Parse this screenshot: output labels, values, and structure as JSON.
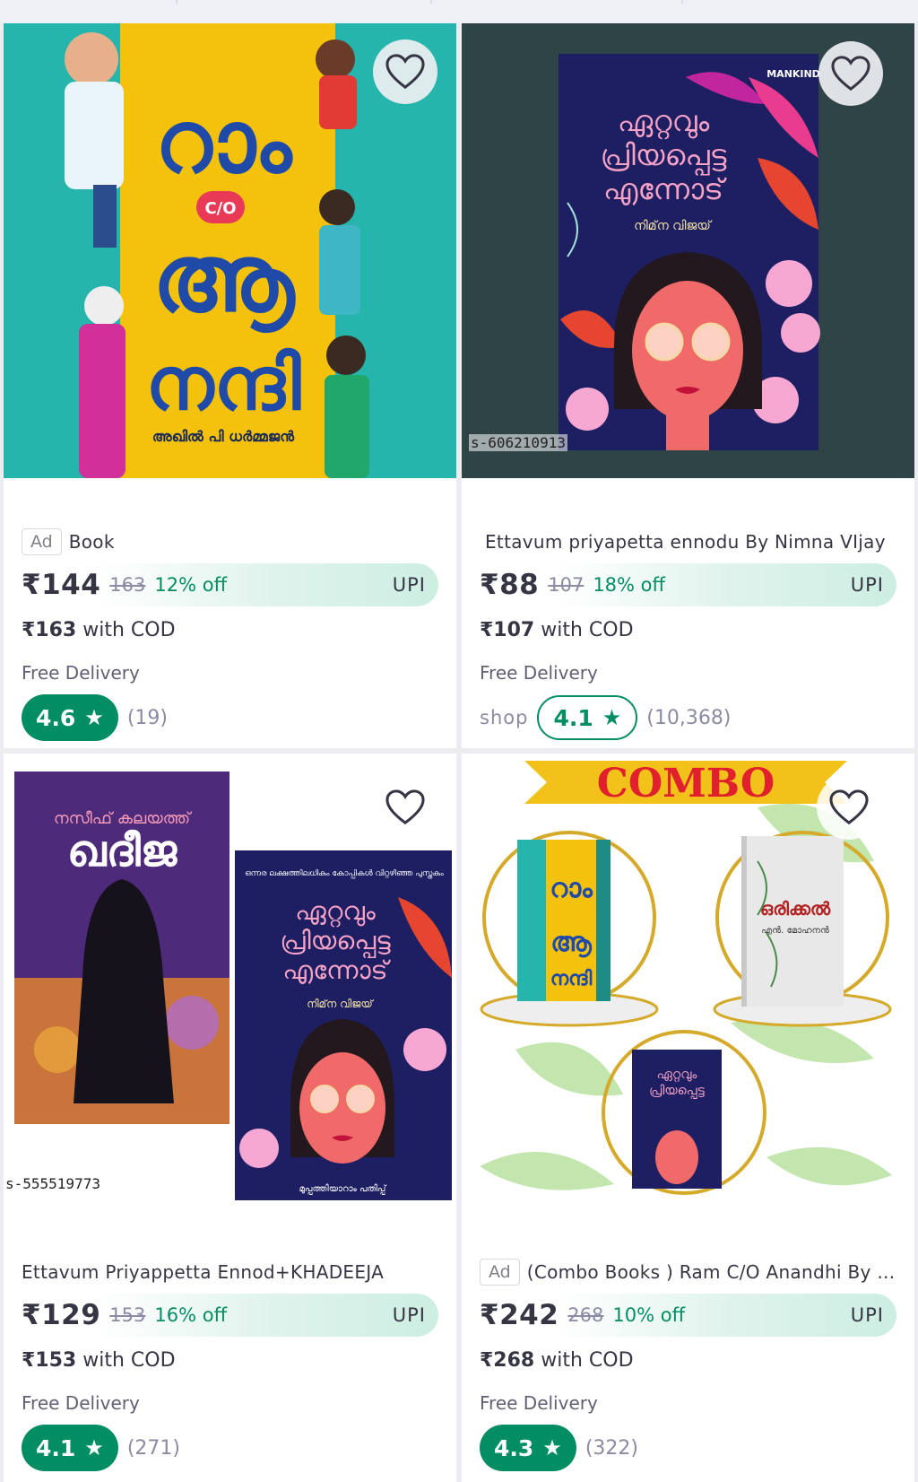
{
  "colors": {
    "accent_green": "#038d63",
    "page_bg": "#ececf1",
    "price_text": "#353543",
    "muted_text": "#8b8ba3"
  },
  "products": [
    {
      "title": "Book",
      "is_ad": true,
      "ad_label": "Ad",
      "price": "₹144",
      "mrp": "163",
      "discount": "12% off",
      "payment_badge": "UPI",
      "cod_price": "₹163",
      "cod_suffix": "with COD",
      "delivery": "Free Delivery",
      "rating": "4.6",
      "rating_count": "(19)",
      "wishlist_icon": "heart-outline-icon",
      "cover_title_lines": [
        "റാം",
        "C/O",
        "ആ",
        "നന്ദി"
      ],
      "cover_author": "അഖിൽ പി ധർമ്മജൻ"
    },
    {
      "title": "Ettavum priyapetta ennodu By Nimna VIjay",
      "is_ad": false,
      "price": "₹88",
      "mrp": "107",
      "discount": "18% off",
      "payment_badge": "UPI",
      "cod_price": "₹107",
      "cod_suffix": "with COD",
      "delivery": "Free Delivery",
      "shop_label": "shop",
      "rating": "4.1",
      "rating_count": "(10,368)",
      "product_code": "s-606210913",
      "wishlist_icon": "heart-outline-icon",
      "cover_title_lines": [
        "ഏറ്റവും",
        "പ്രിയപ്പെട്ട",
        "എന്നോട്"
      ],
      "cover_author": "നിമ്‌ന വിജയ്",
      "publisher_logo": "MANKIND"
    },
    {
      "title": "Ettavum Priyappetta Ennod+KHADEEJA",
      "is_ad": false,
      "price": "₹129",
      "mrp": "153",
      "discount": "16% off",
      "payment_badge": "UPI",
      "cod_price": "₹153",
      "cod_suffix": "with COD",
      "delivery": "Free Delivery",
      "rating": "4.1",
      "rating_count": "(271)",
      "product_code": "s-555519773",
      "wishlist_icon": "heart-outline-icon",
      "cover1_author": "നസീഫ് കലയത്ത്",
      "cover1_title": "ഖദീജ",
      "cover2_tagline": "ഒന്നര ലക്ഷത്തിലധികം കോപ്പികൾ വിറ്റഴിഞ്ഞ പുസ്തകം",
      "cover2_title_lines": [
        "ഏറ്റവും",
        "പ്രിയപ്പെട്ട",
        "എന്നോട്"
      ],
      "cover2_author": "നിമ്‌ന വിജയ്",
      "cover2_edition": "മുപ്പത്തിയാറാം പതിപ്പ്"
    },
    {
      "title": "(Combo Books ) Ram C/O Anandhi By A...",
      "is_ad": true,
      "ad_label": "Ad",
      "price": "₹242",
      "mrp": "268",
      "discount": "10% off",
      "payment_badge": "UPI",
      "cod_price": "₹268",
      "cod_suffix": "with COD",
      "delivery": "Free Delivery",
      "rating": "4.3",
      "rating_count": "(322)",
      "wishlist_icon": "heart-outline-icon",
      "banner": "COMBO",
      "book2_title": "ഒരിക്കൽ",
      "book2_author": "എൻ. മോഹനൻ"
    }
  ]
}
